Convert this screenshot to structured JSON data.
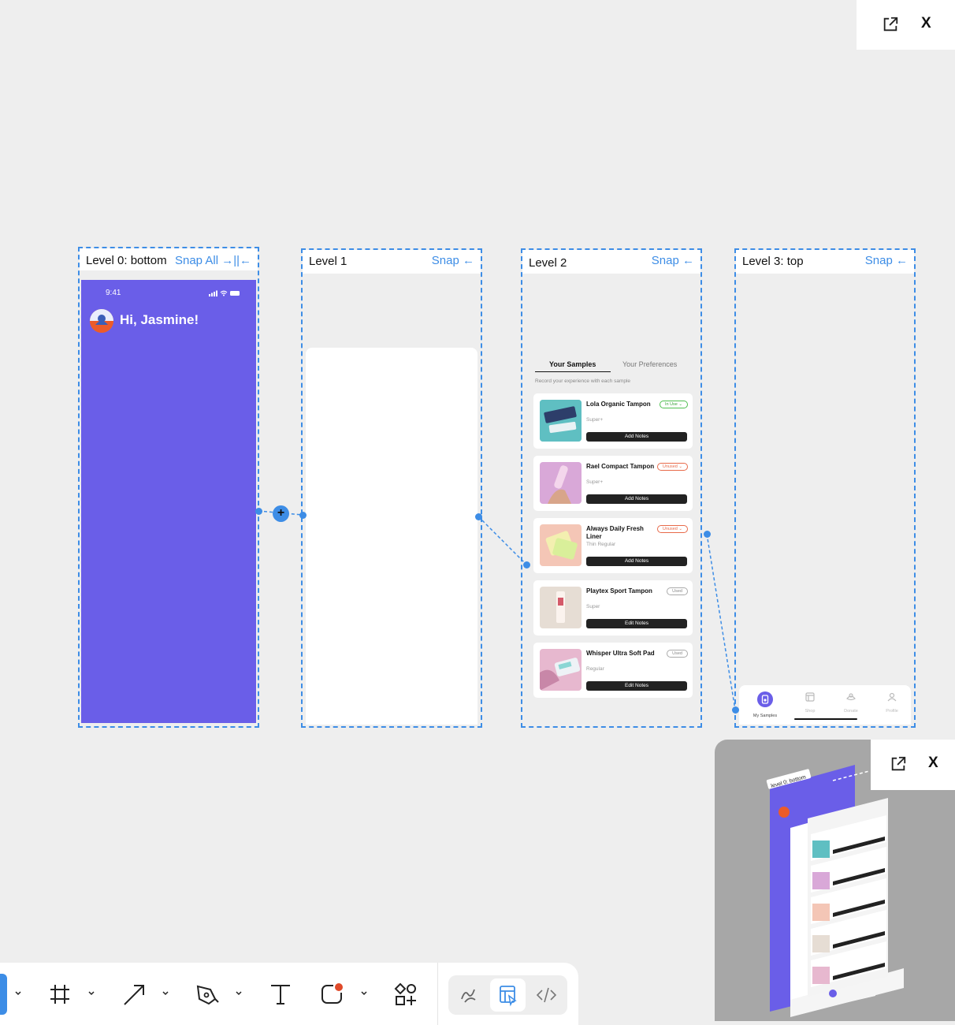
{
  "close_label": "X",
  "levels": [
    {
      "title": "Level 0: bottom",
      "snap": "Snap All →||←"
    },
    {
      "title": "Level 1",
      "snap": "Snap ←"
    },
    {
      "title": "Level 2",
      "snap": "Snap ←"
    },
    {
      "title": "Level 3: top",
      "snap": "Snap ←"
    }
  ],
  "phone": {
    "time": "9:41",
    "greeting": "Hi, Jasmine!"
  },
  "samples": {
    "tabs": [
      "Your Samples",
      "Your Preferences"
    ],
    "subtitle": "Record your experience with each sample",
    "items": [
      {
        "name": "Lola Organic Tampon",
        "sub": "Super+",
        "status": "In Use",
        "status_kind": "inuse",
        "action": "Add Notes"
      },
      {
        "name": "Rael Compact Tampon",
        "sub": "Super+",
        "status": "Unused",
        "status_kind": "unused",
        "action": "Add Notes"
      },
      {
        "name": "Always Daily Fresh Liner",
        "sub": "Thin Regular",
        "status": "Unused",
        "status_kind": "unused",
        "action": "Add Notes"
      },
      {
        "name": "Playtex Sport Tampon",
        "sub": "Super",
        "status": "Used",
        "status_kind": "used",
        "action": "Edit Notes"
      },
      {
        "name": "Whisper Ultra Soft Pad",
        "sub": "Regular",
        "status": "Used",
        "status_kind": "used",
        "action": "Edit Notes"
      }
    ]
  },
  "tabbar": {
    "items": [
      "My Samples",
      "Shop",
      "Donate",
      "Profile"
    ]
  },
  "preview": {
    "label": "level 0: bottom"
  },
  "colors": {
    "accent": "#3d8de6",
    "brand_purple": "#6a5ee8"
  }
}
